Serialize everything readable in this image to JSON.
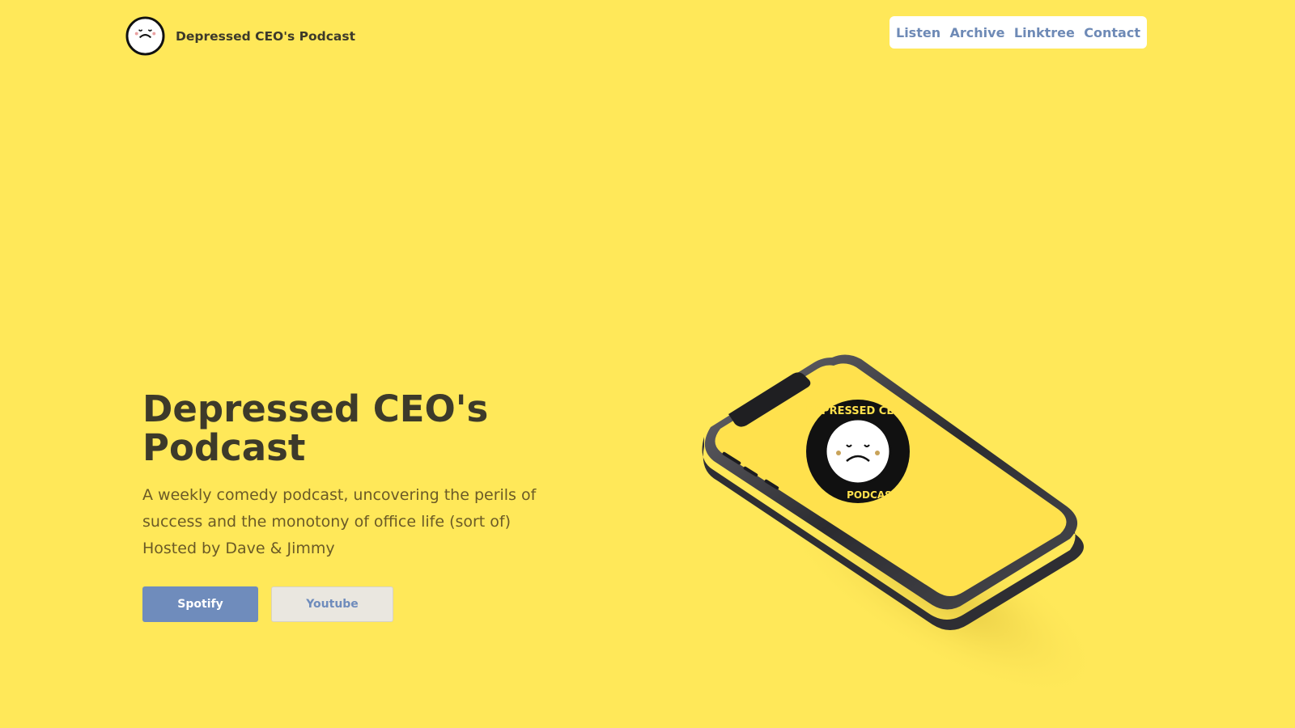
{
  "header": {
    "brand_text": "Depressed CEO's Podcast",
    "logo_icon": "sad-face-icon",
    "nav": [
      {
        "label": "Listen"
      },
      {
        "label": "Archive"
      },
      {
        "label": "Linktree"
      },
      {
        "label": "Contact"
      }
    ]
  },
  "hero": {
    "title": "Depressed CEO's Podcast",
    "description": "A weekly comedy podcast, uncovering the perils of success and the monotony of office life (sort of) Hosted by Dave & Jimmy",
    "buttons": {
      "spotify": "Spotify",
      "youtube": "Youtube"
    }
  },
  "phone": {
    "badge_text_top": "DEPRESSED CEOS",
    "badge_text_bottom": "PODCAST",
    "icon": "smartphone-icon"
  },
  "colors": {
    "background": "#ffe859",
    "primary_button": "#6f8cbc",
    "nav_text": "#6e8ab6",
    "title_text": "#3d3a2a"
  }
}
